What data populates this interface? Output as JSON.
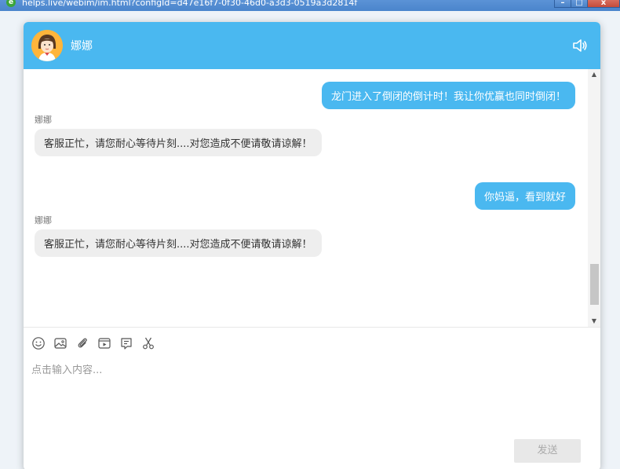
{
  "browser": {
    "url": "helps.live/webim/im.html?configId=d47e16f7-0f30-46d0-a3d3-0519a3d2814f",
    "buttons": {
      "minimize": "–",
      "maximize": "□",
      "close": "x"
    }
  },
  "header": {
    "agent_name": "娜娜",
    "sound_icon": "speaker-icon"
  },
  "messages": [
    {
      "side": "right",
      "text": "龙门进入了倒闭的倒计时！我让你优赢也同时倒闭！"
    },
    {
      "side": "left",
      "sender": "娜娜",
      "text": "客服正忙，请您耐心等待片刻....对您造成不便请敬请谅解！"
    },
    {
      "side": "right",
      "text": "你妈逼，看到就好"
    },
    {
      "side": "left",
      "sender": "娜娜",
      "text": "客服正忙，请您耐心等待片刻....对您造成不便请敬请谅解！"
    }
  ],
  "toolbar": [
    "emoji-icon",
    "image-icon",
    "attachment-icon",
    "video-icon",
    "evaluate-icon",
    "screenshot-icon"
  ],
  "input": {
    "placeholder": "点击输入内容..."
  },
  "send_label": "发送"
}
